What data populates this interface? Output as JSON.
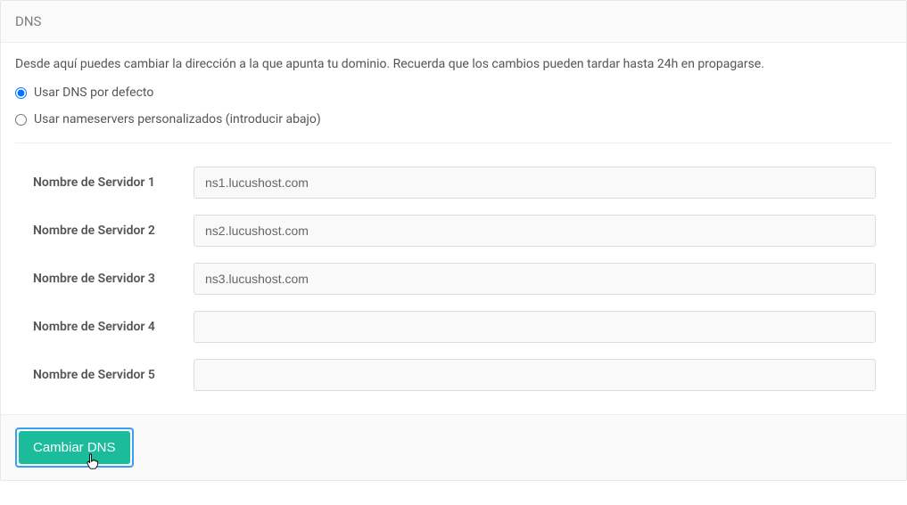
{
  "header": {
    "title": "DNS"
  },
  "body": {
    "description": "Desde aquí puedes cambiar la dirección a la que apunta tu dominio. Recuerda que los cambios pueden tardar hasta 24h en propagarse.",
    "radios": {
      "default": {
        "label": "Usar DNS por defecto",
        "checked": true
      },
      "custom": {
        "label": "Usar nameservers personalizados (introducir abajo)",
        "checked": false
      }
    },
    "nameservers": [
      {
        "label": "Nombre de Servidor 1",
        "value": "ns1.lucushost.com"
      },
      {
        "label": "Nombre de Servidor 2",
        "value": "ns2.lucushost.com"
      },
      {
        "label": "Nombre de Servidor 3",
        "value": "ns3.lucushost.com"
      },
      {
        "label": "Nombre de Servidor 4",
        "value": ""
      },
      {
        "label": "Nombre de Servidor 5",
        "value": ""
      }
    ]
  },
  "footer": {
    "submit_label": "Cambiar DNS"
  }
}
